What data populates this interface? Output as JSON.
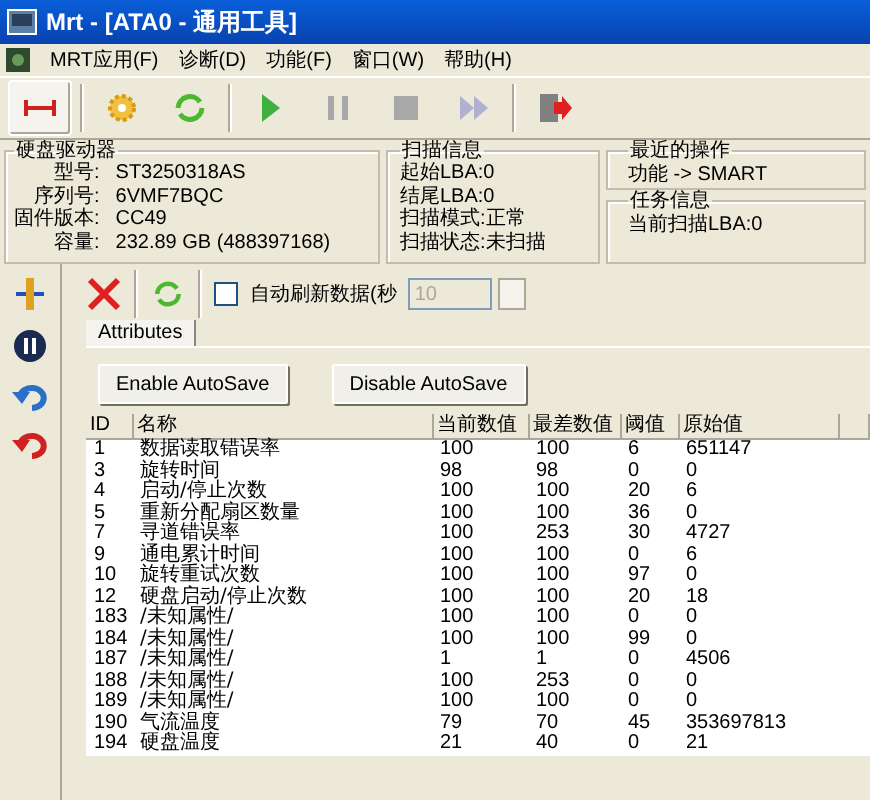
{
  "window": {
    "title": "Mrt - [ATA0 - 通用工具]"
  },
  "menu": [
    "MRT应用(F)",
    "诊断(D)",
    "功能(F)",
    "窗口(W)",
    "帮助(H)"
  ],
  "drive": {
    "title": "硬盘驱动器",
    "fields": [
      {
        "label": "型号:",
        "value": "ST3250318AS"
      },
      {
        "label": "序列号:",
        "value": "6VMF7BQC"
      },
      {
        "label": "固件版本:",
        "value": "CC49"
      },
      {
        "label": "容量:",
        "value": "232.89 GB (488397168)"
      }
    ]
  },
  "scan": {
    "title": "扫描信息",
    "lines": [
      "起始LBA:0",
      "结尾LBA:0",
      "扫描模式:正常",
      "扫描状态:未扫描"
    ]
  },
  "recent": {
    "title": "最近的操作",
    "text": "功能 -> SMART"
  },
  "task": {
    "title": "任务信息",
    "text": "当前扫描LBA:0"
  },
  "auto_refresh": {
    "label": "自动刷新数据(秒",
    "checked": false,
    "value": "10",
    "disabled": true
  },
  "tabs": [
    {
      "label": "Attributes",
      "selected": true
    }
  ],
  "buttons": [
    "Enable AutoSave",
    "Disable AutoSave"
  ],
  "table": {
    "columns": [
      "ID",
      "名称",
      "当前数值",
      "最差数值",
      "阈值",
      "原始值"
    ],
    "rows": [
      [
        "1",
        "数据读取错误率",
        "100",
        "100",
        "6",
        "651147"
      ],
      [
        "3",
        "旋转时间",
        "98",
        "98",
        "0",
        "0"
      ],
      [
        "4",
        "启动/停止次数",
        "100",
        "100",
        "20",
        "6"
      ],
      [
        "5",
        "重新分配扇区数量",
        "100",
        "100",
        "36",
        "0"
      ],
      [
        "7",
        "寻道错误率",
        "100",
        "253",
        "30",
        "4727"
      ],
      [
        "9",
        "通电累计时间",
        "100",
        "100",
        "0",
        "6"
      ],
      [
        "10",
        "旋转重试次数",
        "100",
        "100",
        "97",
        "0"
      ],
      [
        "12",
        "硬盘启动/停止次数",
        "100",
        "100",
        "20",
        "18"
      ],
      [
        "183",
        "/未知属性/",
        "100",
        "100",
        "0",
        "0"
      ],
      [
        "184",
        "/未知属性/",
        "100",
        "100",
        "99",
        "0"
      ],
      [
        "187",
        "/未知属性/",
        "1",
        "1",
        "0",
        "4506"
      ],
      [
        "188",
        "/未知属性/",
        "100",
        "253",
        "0",
        "0"
      ],
      [
        "189",
        "/未知属性/",
        "100",
        "100",
        "0",
        "0"
      ],
      [
        "190",
        "气流温度",
        "79",
        "70",
        "45",
        "353697813"
      ],
      [
        "194",
        "硬盘温度",
        "21",
        "40",
        "0",
        "21"
      ]
    ]
  }
}
